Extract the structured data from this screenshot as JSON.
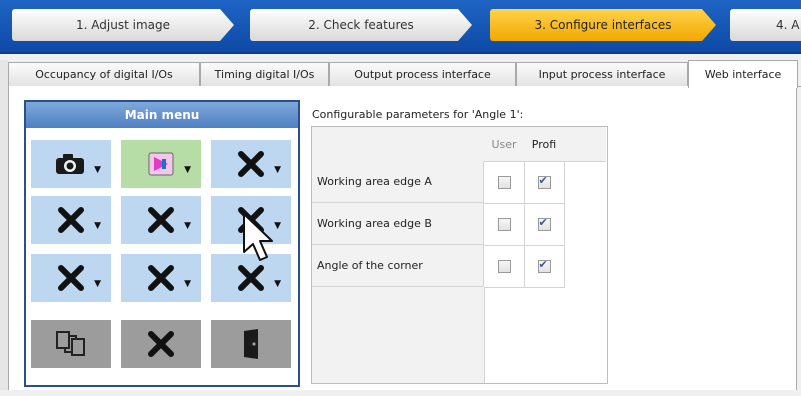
{
  "wizard": {
    "steps": [
      {
        "label": "1. Adjust image"
      },
      {
        "label": "2. Check features"
      },
      {
        "label": "3. Configure interfaces",
        "active": true
      },
      {
        "label": "4. A"
      }
    ]
  },
  "tabs": [
    {
      "label": "Occupancy of digital I/Os"
    },
    {
      "label": "Timing digital I/Os"
    },
    {
      "label": "Output process interface"
    },
    {
      "label": "Input process interface"
    },
    {
      "label": "Web interface",
      "active": true
    }
  ],
  "main_menu": {
    "title": "Main menu",
    "buttons": [
      {
        "icon": "camera-icon",
        "style": "blue"
      },
      {
        "icon": "color-picker-icon",
        "style": "green"
      },
      {
        "icon": "x-icon",
        "style": "blue"
      },
      {
        "icon": "x-icon",
        "style": "blue"
      },
      {
        "icon": "x-icon",
        "style": "blue"
      },
      {
        "icon": "x-icon",
        "style": "blue"
      },
      {
        "icon": "x-icon",
        "style": "blue"
      },
      {
        "icon": "x-icon",
        "style": "blue"
      },
      {
        "icon": "x-icon",
        "style": "blue"
      },
      {
        "icon": "swap-documents-icon",
        "style": "gray"
      },
      {
        "icon": "x-icon",
        "style": "gray"
      },
      {
        "icon": "door-exit-icon",
        "style": "gray"
      }
    ]
  },
  "params": {
    "title": "Configurable parameters for 'Angle 1':",
    "columns": [
      "User",
      "Profi"
    ],
    "rows": [
      {
        "label": "Working area edge A",
        "user": false,
        "profi": true
      },
      {
        "label": "Working area edge B",
        "user": false,
        "profi": true
      },
      {
        "label": "Angle of the corner",
        "user": false,
        "profi": true
      }
    ]
  },
  "colors": {
    "wizard_bg": "#1f64c4",
    "active_step": "#f2a800",
    "menu_button_blue": "#bdd7f1",
    "menu_button_green": "#b6dda6",
    "menu_button_gray": "#9c9c9c",
    "menu_title": "#5f8fcf"
  }
}
